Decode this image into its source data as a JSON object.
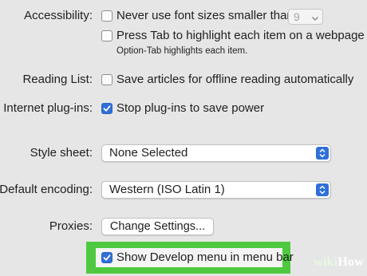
{
  "accessibility": {
    "label": "Accessibility:",
    "min_font_option": "Never use font sizes smaller than",
    "min_font_value": "9",
    "tab_option": "Press Tab to highlight each item on a webpage",
    "tab_hint": "Option-Tab highlights each item."
  },
  "reading_list": {
    "label": "Reading List:",
    "option": "Save articles for offline reading automatically"
  },
  "plugins": {
    "label": "Internet plug-ins:",
    "option": "Stop plug-ins to save power"
  },
  "style_sheet": {
    "label": "Style sheet:",
    "value": "None Selected"
  },
  "encoding": {
    "label": "Default encoding:",
    "value": "Western (ISO Latin 1)"
  },
  "proxies": {
    "label": "Proxies:",
    "button": "Change Settings..."
  },
  "develop": {
    "option": "Show Develop menu in menu bar"
  },
  "watermark": {
    "part1": "wiki",
    "part2": "How"
  },
  "colors": {
    "checkbox_accent": "#2f6fd8",
    "highlight": "#4ec93f",
    "background": "#e6e6e6"
  }
}
